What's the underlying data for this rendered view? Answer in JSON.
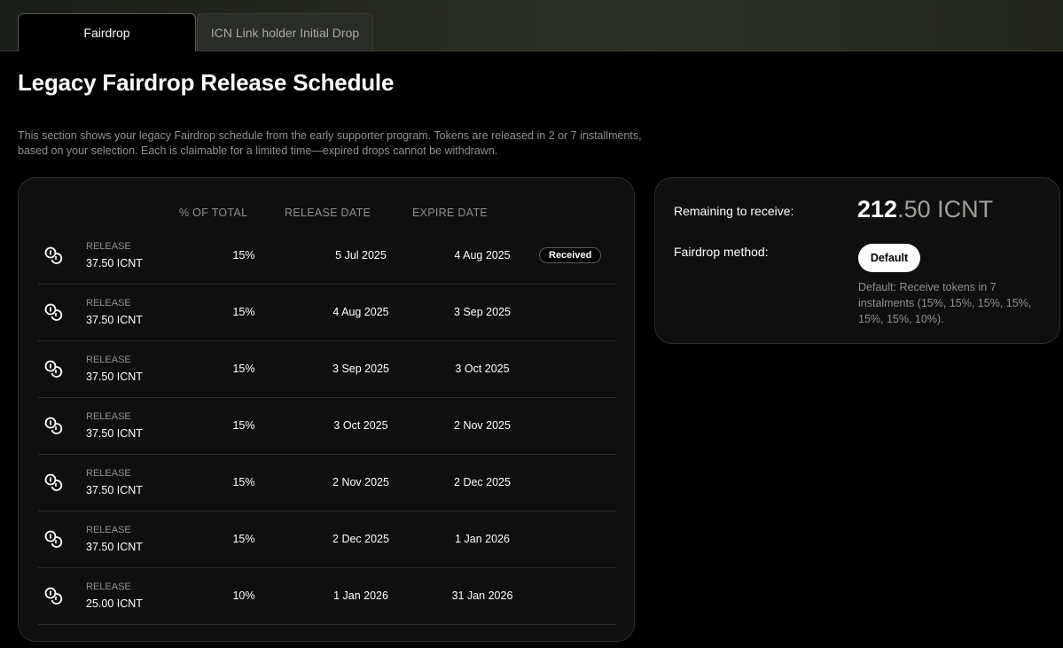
{
  "tabs": [
    {
      "label": "Fairdrop",
      "active": true
    },
    {
      "label": "ICN Link holder Initial Drop",
      "active": false
    }
  ],
  "page": {
    "title": "Legacy Fairdrop Release Schedule",
    "description": "This section shows your legacy Fairdrop schedule from the early supporter program. Tokens are released in 2 or 7 installments, based on your selection. Each is claimable for a limited time—expired drops cannot be withdrawn."
  },
  "schedule": {
    "columns": {
      "percent": "% OF TOTAL",
      "release_date": "RELEASE DATE",
      "expire_date": "EXPIRE DATE"
    },
    "rows": [
      {
        "icon": "coins-icon",
        "label": "RELEASE",
        "amount": "37.50 ICNT",
        "percent": "15%",
        "release_date": "5 Jul 2025",
        "expire_date": "4 Aug 2025",
        "status": "Received"
      },
      {
        "icon": "coins-icon",
        "label": "RELEASE",
        "amount": "37.50 ICNT",
        "percent": "15%",
        "release_date": "4 Aug 2025",
        "expire_date": "3 Sep 2025",
        "status": ""
      },
      {
        "icon": "coins-icon",
        "label": "RELEASE",
        "amount": "37.50 ICNT",
        "percent": "15%",
        "release_date": "3 Sep 2025",
        "expire_date": "3 Oct 2025",
        "status": ""
      },
      {
        "icon": "coins-icon",
        "label": "RELEASE",
        "amount": "37.50 ICNT",
        "percent": "15%",
        "release_date": "3 Oct 2025",
        "expire_date": "2 Nov 2025",
        "status": ""
      },
      {
        "icon": "coins-icon",
        "label": "RELEASE",
        "amount": "37.50 ICNT",
        "percent": "15%",
        "release_date": "2 Nov 2025",
        "expire_date": "2 Dec 2025",
        "status": ""
      },
      {
        "icon": "coins-icon",
        "label": "RELEASE",
        "amount": "37.50 ICNT",
        "percent": "15%",
        "release_date": "2 Dec 2025",
        "expire_date": "1 Jan 2026",
        "status": ""
      },
      {
        "icon": "coins-icon",
        "label": "RELEASE",
        "amount": "25.00 ICNT",
        "percent": "10%",
        "release_date": "1 Jan 2026",
        "expire_date": "31 Jan 2026",
        "status": ""
      }
    ]
  },
  "summary": {
    "remaining_label": "Remaining to receive:",
    "remaining_whole": "212",
    "remaining_rest": ".50 ICNT",
    "method_label": "Fairdrop method:",
    "method_button": "Default",
    "method_note": "Default: Receive tokens in 7 instalments (15%, 15%, 15%, 15%, 15%, 15%, 10%)."
  },
  "colors": {
    "background": "#000000",
    "card": "#0f0f0f",
    "muted_text": "#8d908a",
    "button_bg": "#ffffff"
  }
}
